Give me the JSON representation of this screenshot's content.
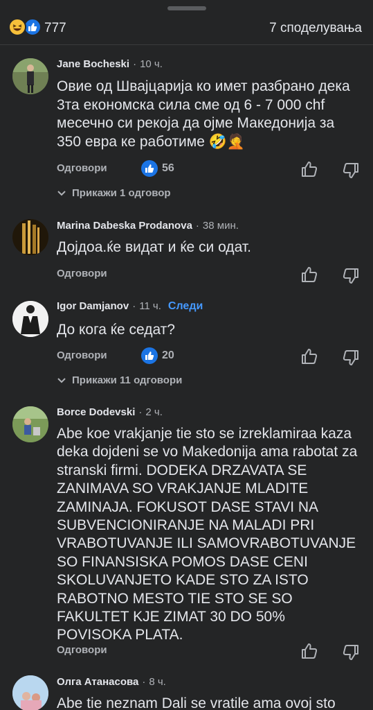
{
  "header": {
    "reactions": [
      "haha-icon",
      "like-icon"
    ],
    "reaction_count": "777",
    "shares_label": "7 споделувања"
  },
  "comments": [
    {
      "author": "Jane Bocheski",
      "time": "10 ч.",
      "text": "Овие од Швајцарија ко имет разбрано дека 3та економска сила сме од 6 - 7 000 chf месечно си рекоја да ојме Македонија за 350 евра ке работиме 🤣🤦",
      "reply_label": "Одговори",
      "likes": "56",
      "show_replies": "Прикажи 1 одговор"
    },
    {
      "author": "Marina Dabeska Prodanova",
      "time": "38 мин.",
      "text": "Дојдоа.ќе видат и ќе си одат.",
      "reply_label": "Одговори"
    },
    {
      "author": "Igor Damjanov",
      "time": "11 ч.",
      "follow_label": "Следи",
      "text": "До кога ќе седат?",
      "reply_label": "Одговори",
      "likes": "20",
      "show_replies": "Прикажи 11 одговори"
    },
    {
      "author": "Borce Dodevski",
      "time": "2 ч.",
      "text": "Abe koe vrakjanje tie sto se izreklamiraa kaza deka dojdeni se vo Makedonija ama rabotat za stranski firmi. DODEKA DRZAVATA SE ZANIMAVA SO VRAKJANJE MLADITE ZAMINAJA. FOKUSOT DASE STAVI NA SUBVENCIONIRANJE NA MALADI  PRI VRABOTUVANJE ILI SAMOVRABOTUVANJE SO FINANSISKA POMOS  DASE CENI SKOLUVANJETO KADE STO ZA ISTO RABOTNO MESTO TIE STO SE SO FAKULTET KJE ZIMAT 30 DO 50% POVISOKA PLATA.",
      "reply_label": "Одговори"
    },
    {
      "author": "Олга Атанасова",
      "time": "8 ч.",
      "text": "Abe tie neznam Dali se vratile ama ovoj sto"
    }
  ],
  "colors": {
    "background": "#242526",
    "text": "#e4e6eb",
    "secondary": "#b0b3b8",
    "accent": "#1b74e4",
    "follow": "#4599ff"
  }
}
